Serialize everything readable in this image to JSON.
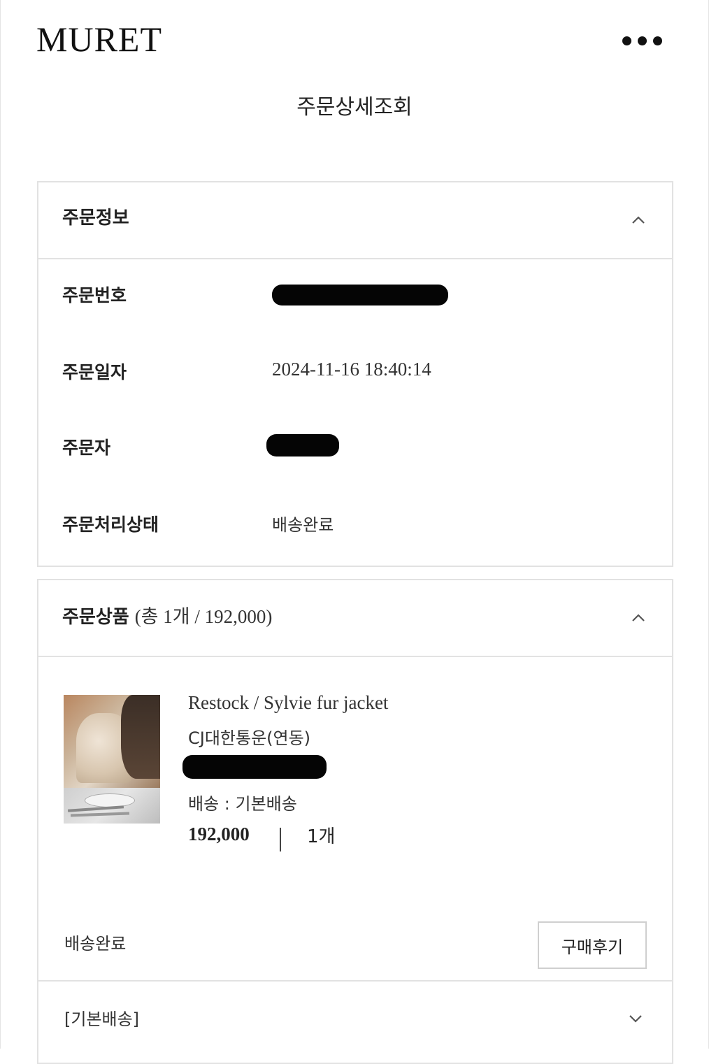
{
  "header": {
    "logo": "MURET",
    "more_icon": "more-dots-icon"
  },
  "page": {
    "title": "주문상세조회"
  },
  "order_info": {
    "title": "주문정보",
    "toggle_icon": "chevron-up-icon",
    "rows": [
      {
        "label": "주문번호",
        "value": ""
      },
      {
        "label": "주문일자",
        "value": "2024-11-16 18:40:14"
      },
      {
        "label": "주문자",
        "value": ""
      },
      {
        "label": "주문처리상태",
        "value": "배송완료"
      }
    ]
  },
  "order_products": {
    "title": "주문상품",
    "summary": "(총 1개 / 192,000)",
    "toggle_icon": "chevron-up-icon",
    "item": {
      "name": "Restock / Sylvie fur jacket",
      "courier": "CJ대한통운(연동)",
      "tracking": "",
      "shipping": "배송 : 기본배송",
      "price": "192,000",
      "quantity": "1개"
    },
    "status": "배송완료",
    "review_button": "구매후기",
    "shipping_group": {
      "label": "[기본배송]",
      "toggle_icon": "chevron-down-icon"
    }
  }
}
